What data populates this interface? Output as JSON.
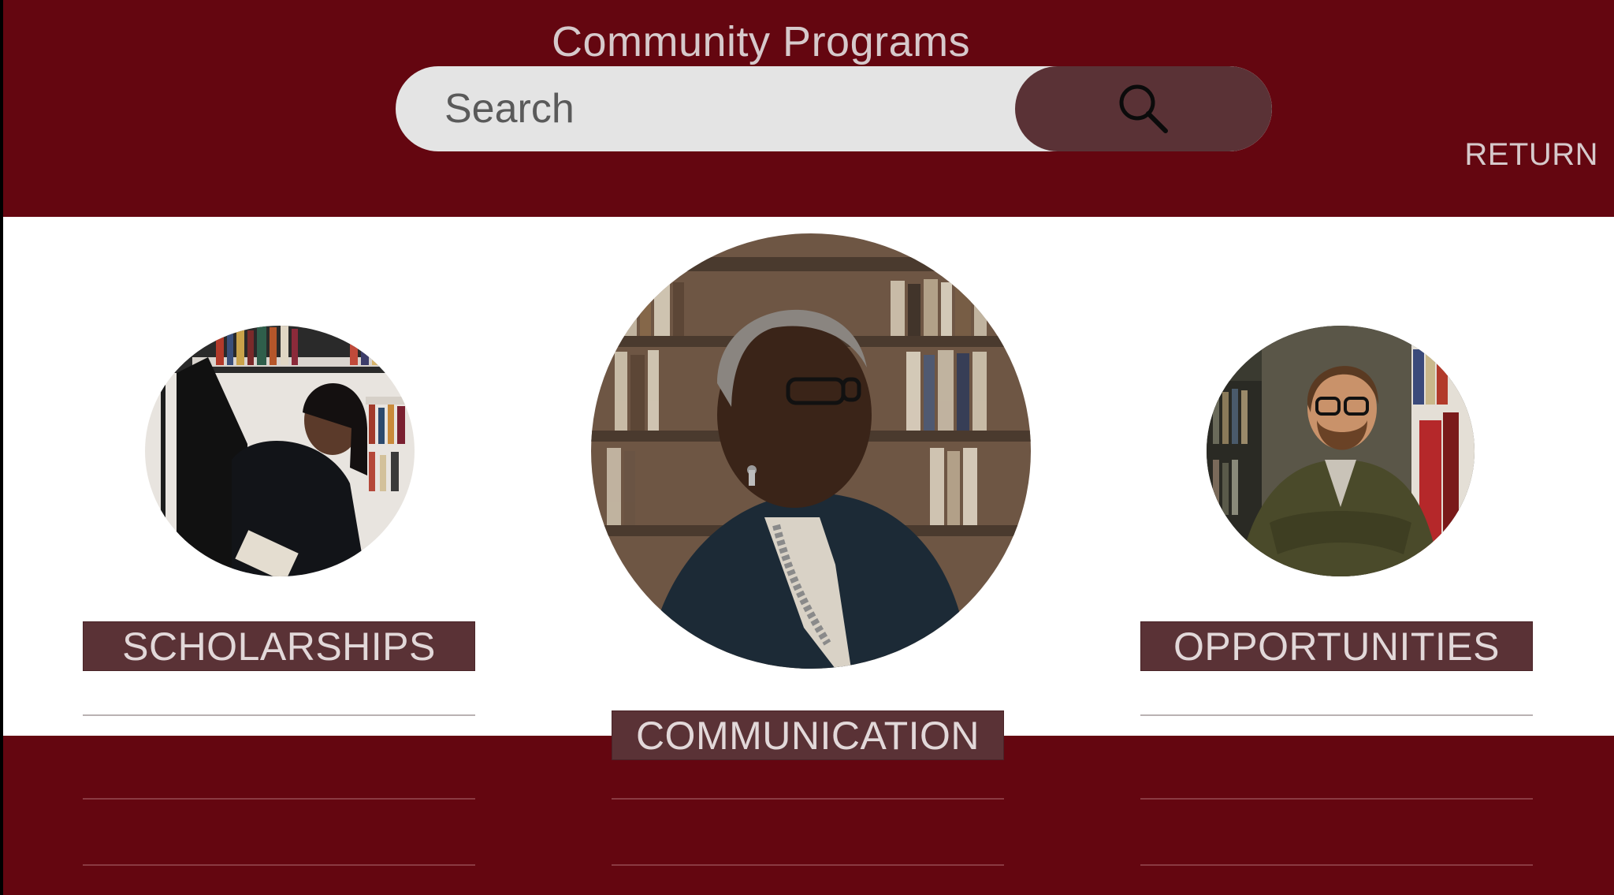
{
  "header": {
    "title": "Community Programs",
    "search_placeholder": "Search",
    "search_icon": "search-icon",
    "return_label": "RETURN"
  },
  "programs": [
    {
      "label": "SCHOLARSHIPS",
      "photo": "woman reaching for a book on library shelf"
    },
    {
      "label": "COMMUNICATION",
      "photo": "older woman with glasses in front of bookshelves"
    },
    {
      "label": "OPPORTUNITIES",
      "photo": "bearded man with glasses, arms crossed, in library"
    }
  ],
  "colors": {
    "brand": "#640610",
    "accent": "#5a3236",
    "search_bg": "#e4e4e4"
  }
}
